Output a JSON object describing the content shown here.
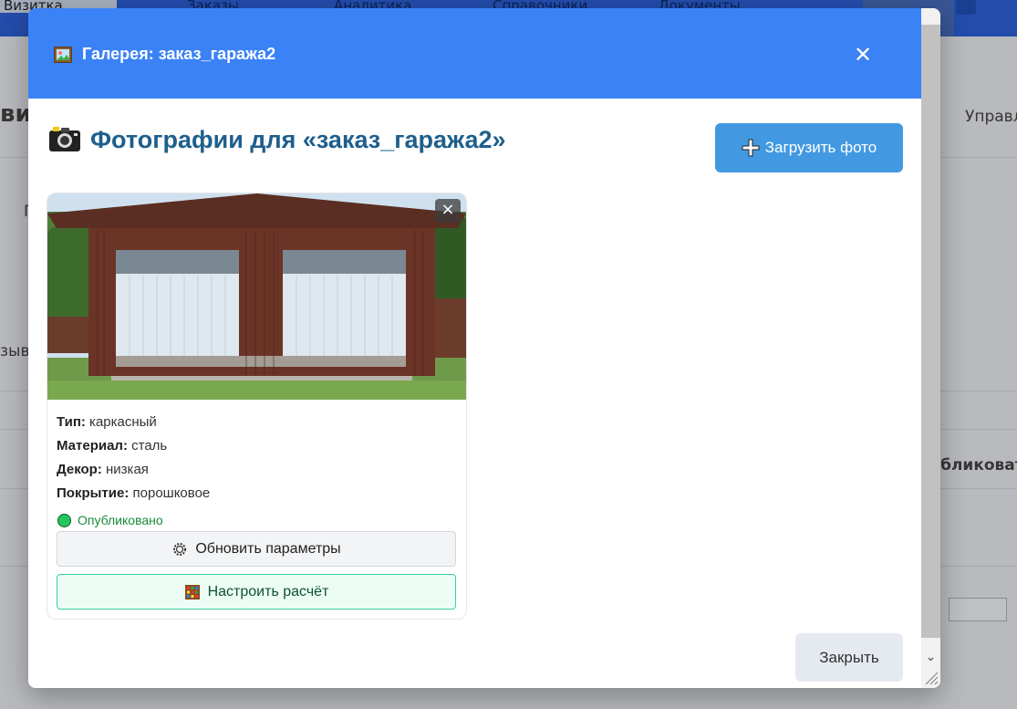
{
  "background": {
    "nav_tabs": [
      "Визитка",
      "Заказы",
      "Аналитика",
      "Справочники",
      "Документы"
    ],
    "left_text_1": "виз",
    "left_text_2": "П",
    "left_text_3": "зыв",
    "right_text_1": "Управл",
    "right_text_2": "убликоват"
  },
  "modal": {
    "header_title": "Галерея: заказ_гаража2",
    "close_symbol": "✕",
    "gallery_title": "Фотографии для «заказ_гаража2»",
    "upload_label": "Загрузить фото",
    "footer_close_label": "Закрыть"
  },
  "photo_card": {
    "delete_symbol": "×",
    "properties": [
      {
        "label": "Тип:",
        "value": "каркасный"
      },
      {
        "label": "Материал:",
        "value": "сталь"
      },
      {
        "label": "Декор:",
        "value": "низкая"
      },
      {
        "label": "Покрытие:",
        "value": "порошковое"
      }
    ],
    "status_text": "Опубликовано",
    "update_label": "Обновить параметры",
    "calc_label": "Настроить расчёт"
  },
  "colors": {
    "header_blue": "#3b82f6",
    "upload_blue": "#4299e1",
    "title_blue": "#1e5f8c",
    "status_green": "#22c55e",
    "calc_border": "#34d399"
  },
  "icons": [
    "frame-picture-icon",
    "camera-icon",
    "plus-icon",
    "gear-icon",
    "abacus-icon",
    "close-icon"
  ]
}
